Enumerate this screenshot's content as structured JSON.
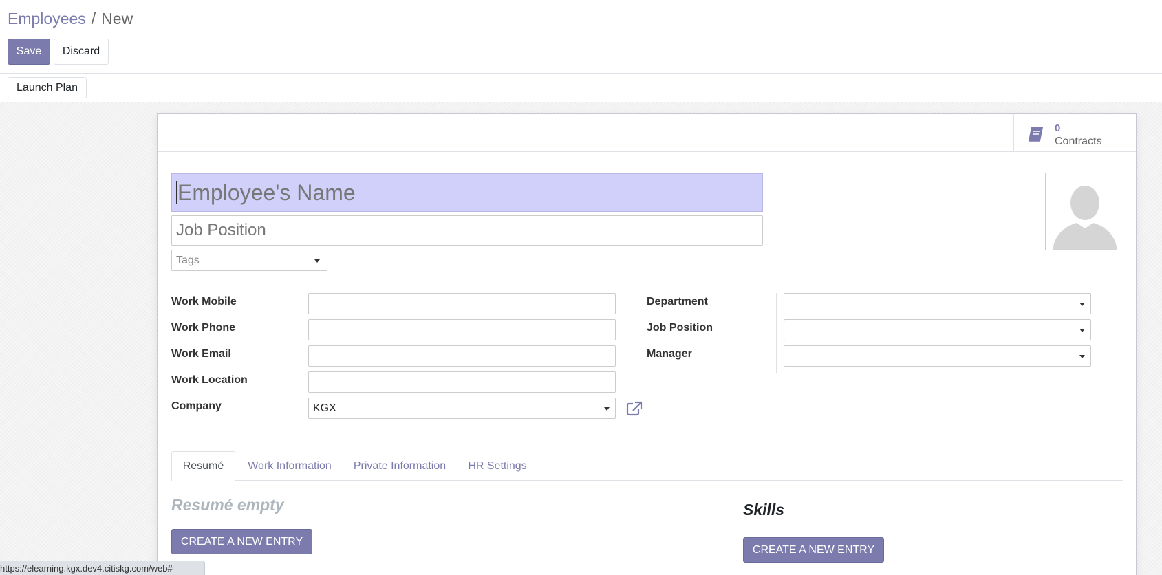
{
  "breadcrumb": {
    "parent": "Employees",
    "separator": "/",
    "current": "New"
  },
  "toolbar": {
    "save_label": "Save",
    "discard_label": "Discard"
  },
  "statusbar": {
    "launch_plan_label": "Launch Plan"
  },
  "stat_button": {
    "value": "0",
    "label": "Contracts",
    "icon": "book-icon"
  },
  "form": {
    "name_placeholder": "Employee's Name",
    "job_position_placeholder": "Job Position",
    "tags_placeholder": "Tags",
    "left_fields": [
      {
        "label": "Work Mobile",
        "value": ""
      },
      {
        "label": "Work Phone",
        "value": ""
      },
      {
        "label": "Work Email",
        "value": ""
      },
      {
        "label": "Work Location",
        "value": ""
      },
      {
        "label": "Company",
        "value": "KGX"
      }
    ],
    "right_fields": [
      {
        "label": "Department",
        "value": ""
      },
      {
        "label": "Job Position",
        "value": ""
      },
      {
        "label": "Manager",
        "value": ""
      }
    ]
  },
  "tabs": [
    {
      "label": "Resumé",
      "active": true
    },
    {
      "label": "Work Information",
      "active": false
    },
    {
      "label": "Private Information",
      "active": false
    },
    {
      "label": "HR Settings",
      "active": false
    }
  ],
  "resume": {
    "empty_title": "Resumé empty",
    "create_label": "CREATE A NEW ENTRY"
  },
  "skills": {
    "title": "Skills",
    "create_label": "CREATE A NEW ENTRY"
  },
  "browser_status": {
    "url": "https://elearning.kgx.dev4.citiskg.com/web#"
  },
  "colors": {
    "accent": "#7c7bad",
    "name_bg": "#d0d0fa"
  }
}
